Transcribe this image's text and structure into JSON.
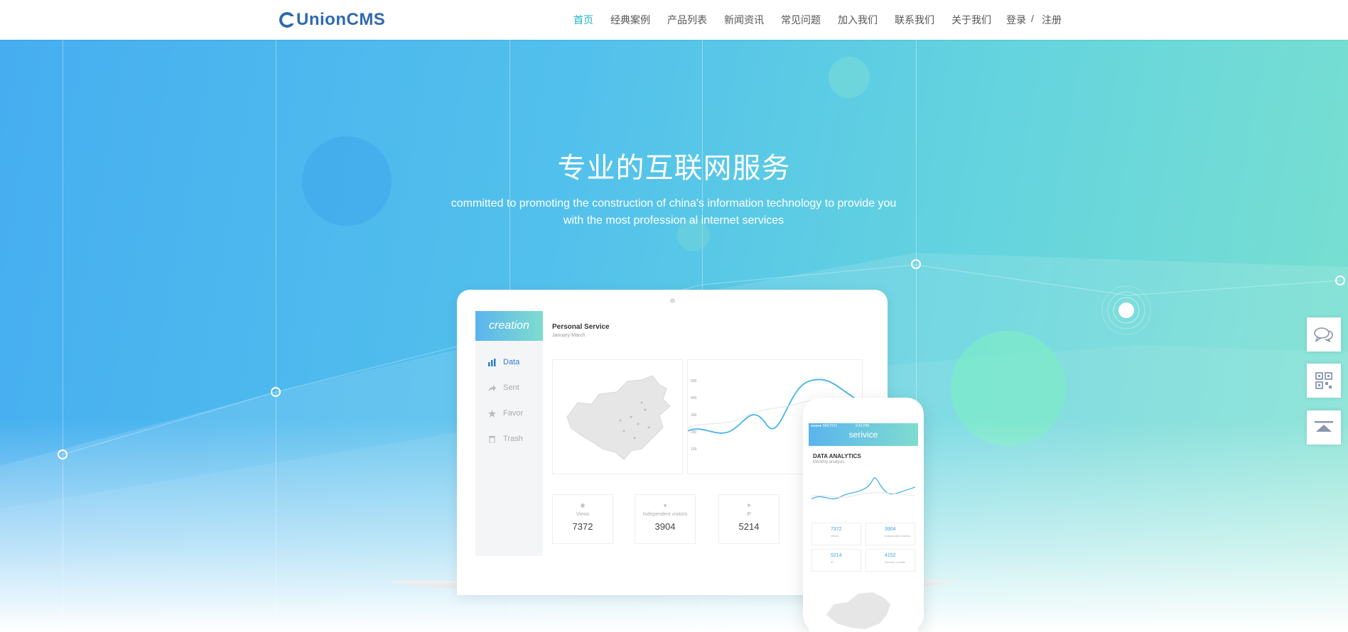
{
  "header": {
    "logo_text": "UnionCMS",
    "nav": [
      {
        "label": "首页",
        "active": true
      },
      {
        "label": "经典案例",
        "active": false
      },
      {
        "label": "产品列表",
        "active": false
      },
      {
        "label": "新闻资讯",
        "active": false
      },
      {
        "label": "常见问题",
        "active": false
      },
      {
        "label": "加入我们",
        "active": false
      },
      {
        "label": "联系我们",
        "active": false
      },
      {
        "label": "关于我们",
        "active": false
      }
    ],
    "login_label": "登录",
    "separator": "/",
    "register_label": "注册"
  },
  "hero": {
    "title": "专业的互联网服务",
    "subtitle_line1": "committed to promoting the construction of china's information technology to provide you",
    "subtitle_line2": "with the most profession al internet services"
  },
  "laptop": {
    "brand": "creation",
    "sidebar": [
      {
        "label": "Data",
        "icon": "bar-chart-icon",
        "active": true
      },
      {
        "label": "Sent",
        "icon": "share-arrow-icon",
        "active": false
      },
      {
        "label": "Favor",
        "icon": "star-icon",
        "active": false
      },
      {
        "label": "Trash",
        "icon": "trash-icon",
        "active": false
      }
    ],
    "panel_title": "Personal Service",
    "panel_subtitle": "January-March",
    "chart_ticks": [
      "500",
      "400",
      "300",
      "200",
      "100"
    ],
    "stats": [
      {
        "label": "Views",
        "value": "7372",
        "icon": "eye-icon"
      },
      {
        "label": "Independent visitors",
        "value": "3904",
        "icon": "user-icon"
      },
      {
        "label": "IP",
        "value": "5214",
        "icon": "send-icon"
      }
    ]
  },
  "phone": {
    "status_left": "●●●●● SKETCH",
    "status_time": "9:41 PM",
    "title": "serivice",
    "section_title": "DATA ANALYTICS",
    "section_sub": "Monthly analysis",
    "stats": [
      {
        "value": "7372",
        "label": "Views"
      },
      {
        "value": "3904",
        "label": "Independent visitors"
      },
      {
        "value": "5214",
        "label": "IP"
      },
      {
        "value": "4152",
        "label": "Number of visits"
      }
    ]
  },
  "floating_tools": [
    {
      "name": "chat-icon"
    },
    {
      "name": "qrcode-icon"
    },
    {
      "name": "back-to-top-icon"
    }
  ],
  "colors": {
    "brand": "#2f69b2",
    "nav_active": "#1fb4c4",
    "hero_start": "#46aef0",
    "hero_end": "#7ae0cf"
  }
}
